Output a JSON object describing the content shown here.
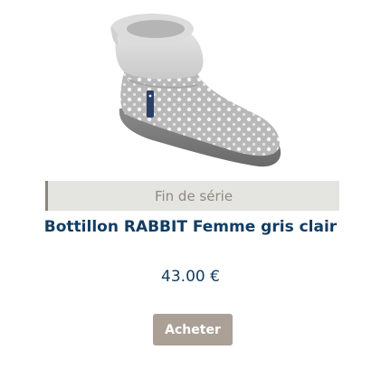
{
  "product": {
    "image_alt": "Bottillon RABBIT Femme gris clair",
    "status": "Fin de série",
    "title": "Bottillon RABBIT Femme gris clair",
    "price": "43.00 €",
    "buy_label": "Acheter"
  },
  "colors": {
    "title": "#123d63",
    "banner_bg": "#e4e4e0",
    "banner_text": "#8f8a83",
    "button_bg": "#aba096"
  },
  "icons": {
    "product_image": "slipper-boot-illustration"
  }
}
